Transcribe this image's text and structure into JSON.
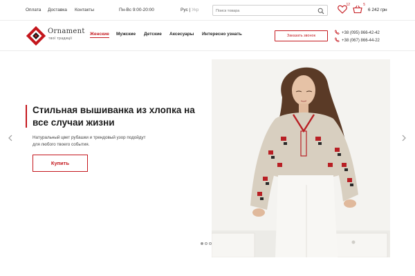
{
  "topbar": {
    "links": [
      "Оплата",
      "Доставка",
      "Контакты"
    ],
    "hours": "Пн-Вс 9:00-20:00",
    "lang_active": "Рус",
    "lang_separator": "|",
    "lang_other": "Укр",
    "search_placeholder": "Поиск товара",
    "wishlist_count": "12",
    "cart_count": "5",
    "cart_total": "6 242 грн"
  },
  "logo": {
    "name": "Ornament",
    "tagline": "твої традиції"
  },
  "nav": {
    "items": [
      {
        "label": "Женские",
        "active": true
      },
      {
        "label": "Мужские",
        "active": false
      },
      {
        "label": "Детские",
        "active": false
      },
      {
        "label": "Аксесуары",
        "active": false
      },
      {
        "label": "Интересно узнать",
        "active": false
      }
    ]
  },
  "header": {
    "callback_label": "Заказать звонок",
    "phones": [
      "+38 (095) 866-42-42",
      "+38 (067) 866-44-22"
    ]
  },
  "hero": {
    "title": "Стильная вышиванка из хлопка на все случаи жизни",
    "subtitle": "Натуральный цвет рубашки и трендовый узор подойдут для любого твоего события.",
    "button_label": "Купить",
    "slides_total": 3,
    "slide_active": 1
  },
  "colors": {
    "accent": "#c4161c",
    "text": "#222222",
    "border": "#cfcfcf"
  },
  "icons": {
    "search": "search-icon",
    "wishlist": "heart-icon",
    "cart": "basket-icon",
    "phone": "phone-icon",
    "prev": "chevron-left-icon",
    "next": "chevron-right-icon"
  }
}
